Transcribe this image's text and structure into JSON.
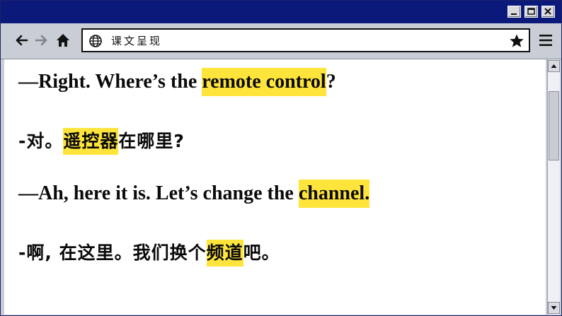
{
  "address_bar": {
    "url_text": "课文呈现"
  },
  "content": {
    "lines": [
      {
        "lang": "en",
        "before": "—Right. Where’s the ",
        "highlight": "remote control",
        "after": "?"
      },
      {
        "lang": "zh",
        "before": "-对。",
        "highlight": "遥控器",
        "after": "在哪里?"
      },
      {
        "lang": "en",
        "before": "—Ah, here it is. Let’s change the ",
        "highlight": "channel.",
        "after": ""
      },
      {
        "lang": "zh",
        "before": "-啊, 在这里。我们换个",
        "highlight": "频道",
        "after": "吧。"
      }
    ]
  },
  "icons": {
    "back": "arrow-left-icon",
    "forward": "arrow-right-icon",
    "home": "home-icon",
    "site": "globe-icon",
    "bookmark": "star-icon",
    "menu": "hamburger-menu-icon",
    "minimize": "minimize-icon",
    "maximize": "maximize-icon",
    "close": "close-icon"
  },
  "colors": {
    "titlebar": "#0b1a7a",
    "chrome": "#c8cdd6",
    "highlight": "#ffe53b",
    "text": "#0b0b0b"
  }
}
